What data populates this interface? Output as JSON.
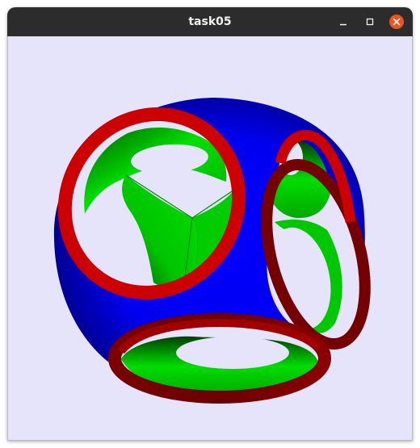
{
  "window": {
    "title": "task05",
    "minimize_icon": "minimize-icon",
    "maximize_icon": "maximize-icon",
    "close_icon": "close-icon"
  },
  "colors": {
    "titlebar": "#2c2c2c",
    "title_text": "#f2f2f2",
    "close_button": "#e9541f",
    "viewport_background": "#e5e4fb",
    "shape_body": "#0000ff",
    "shape_rims": "#cc0000",
    "shape_interior": "#00dd00"
  }
}
